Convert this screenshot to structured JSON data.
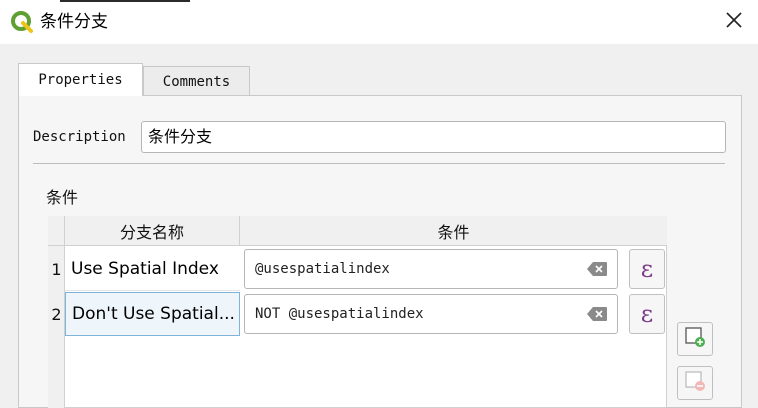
{
  "window": {
    "title": "条件分支",
    "close_icon": "close-icon",
    "app_icon": "qgis-logo-icon"
  },
  "tabs": [
    {
      "label": "Properties",
      "active": true
    },
    {
      "label": "Comments",
      "active": false
    }
  ],
  "properties": {
    "description_label": "Description",
    "description_value": "条件分支",
    "conditions_label": "条件",
    "table": {
      "columns": [
        "分支名称",
        "条件"
      ],
      "rows": [
        {
          "index": "1",
          "name": "Use Spatial Index",
          "condition": "@usespatialindex"
        },
        {
          "index": "2",
          "name": "Don't Use Spatial...",
          "condition": "NOT @usespatialindex"
        }
      ]
    },
    "expression_button": "ε",
    "side_buttons": [
      "add-row-icon",
      "remove-row-icon"
    ]
  },
  "colors": {
    "qgis_green": "#5fa032",
    "epsilon": "#7b3a88",
    "selection_border": "#7fb3d9"
  }
}
